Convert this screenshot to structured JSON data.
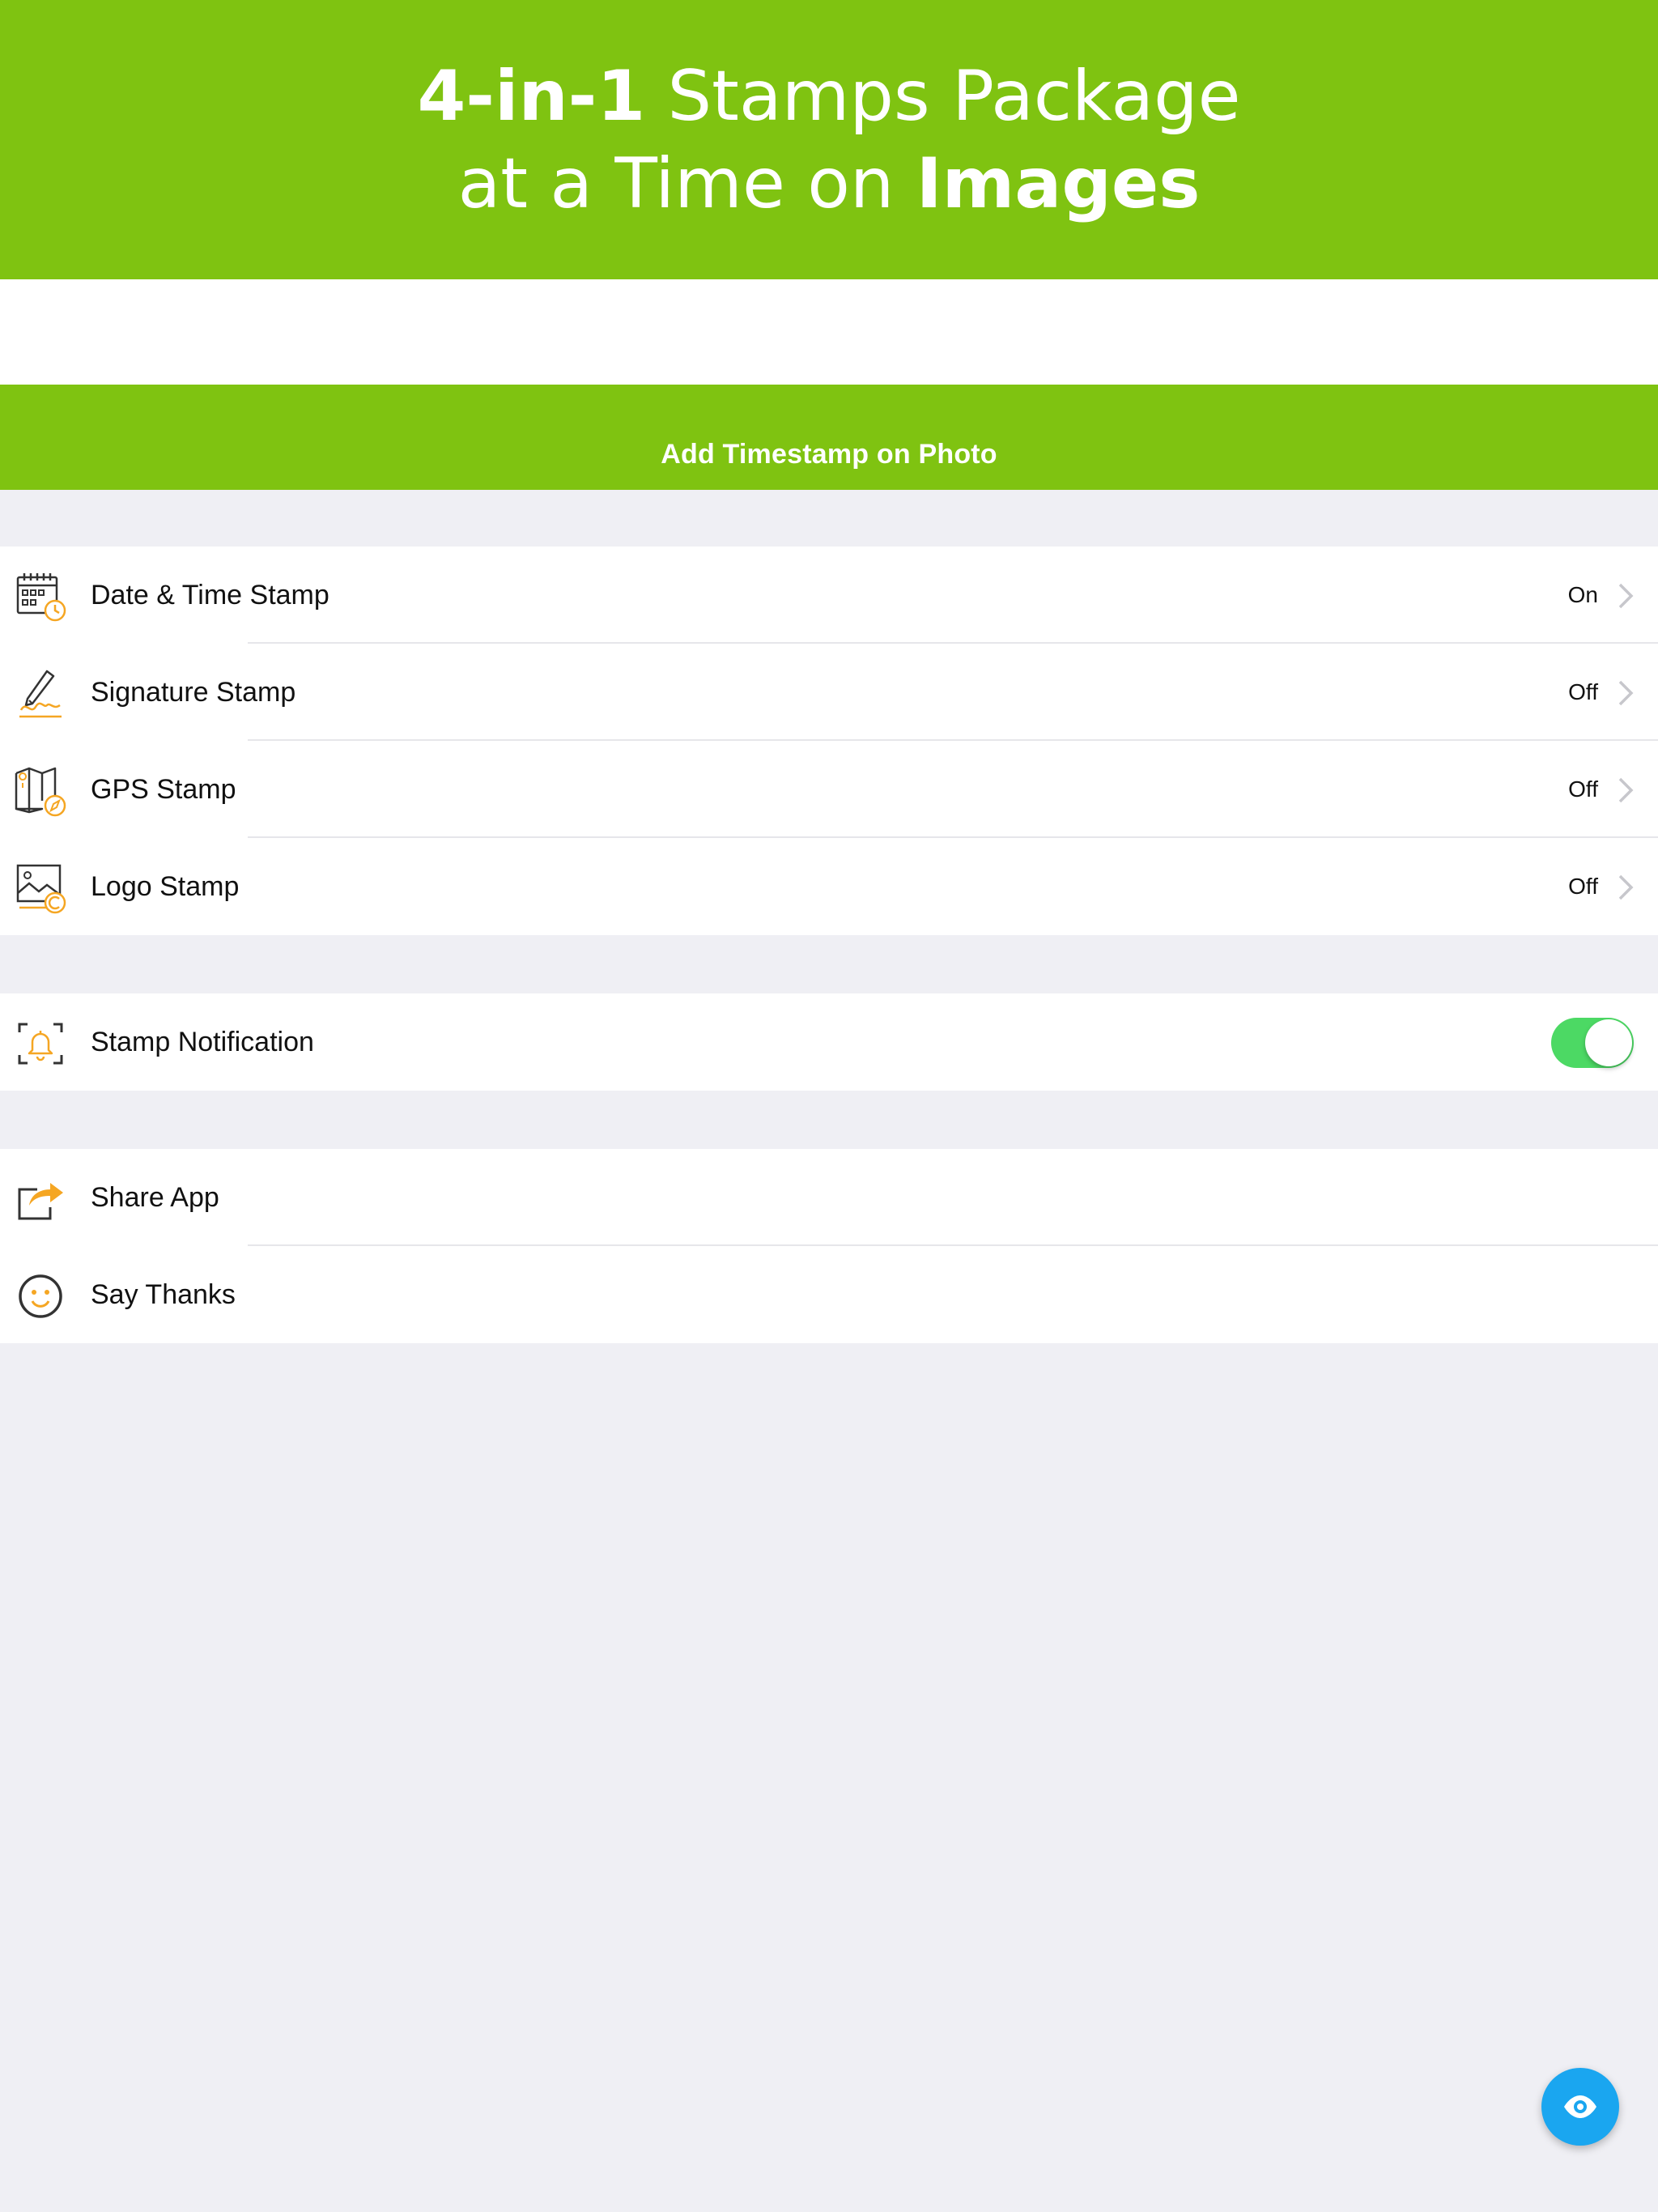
{
  "banner": {
    "line1_bold": "4-in-1",
    "line1_rest": " Stamps Package",
    "line2_rest": "at a Time on ",
    "line2_bold": "Images"
  },
  "navbar": {
    "title": "Add Timestamp on Photo"
  },
  "stamps": [
    {
      "label": "Date & Time Stamp",
      "value": "On",
      "icon": "calendar-clock-icon"
    },
    {
      "label": "Signature Stamp",
      "value": "Off",
      "icon": "signature-pen-icon"
    },
    {
      "label": "GPS Stamp",
      "value": "Off",
      "icon": "map-compass-icon"
    },
    {
      "label": "Logo Stamp",
      "value": "Off",
      "icon": "image-copyright-icon"
    }
  ],
  "notification": {
    "label": "Stamp Notification",
    "enabled": true,
    "icon": "bell-icon"
  },
  "extras": [
    {
      "label": "Share App",
      "icon": "share-icon"
    },
    {
      "label": "Say Thanks",
      "icon": "smiley-icon"
    }
  ],
  "fab": {
    "icon": "eye-icon"
  },
  "colors": {
    "brand_green": "#7fc311",
    "accent_orange": "#f5a623",
    "toggle_green": "#4cd964",
    "fab_blue": "#1aa6f0",
    "background": "#efeff4"
  }
}
